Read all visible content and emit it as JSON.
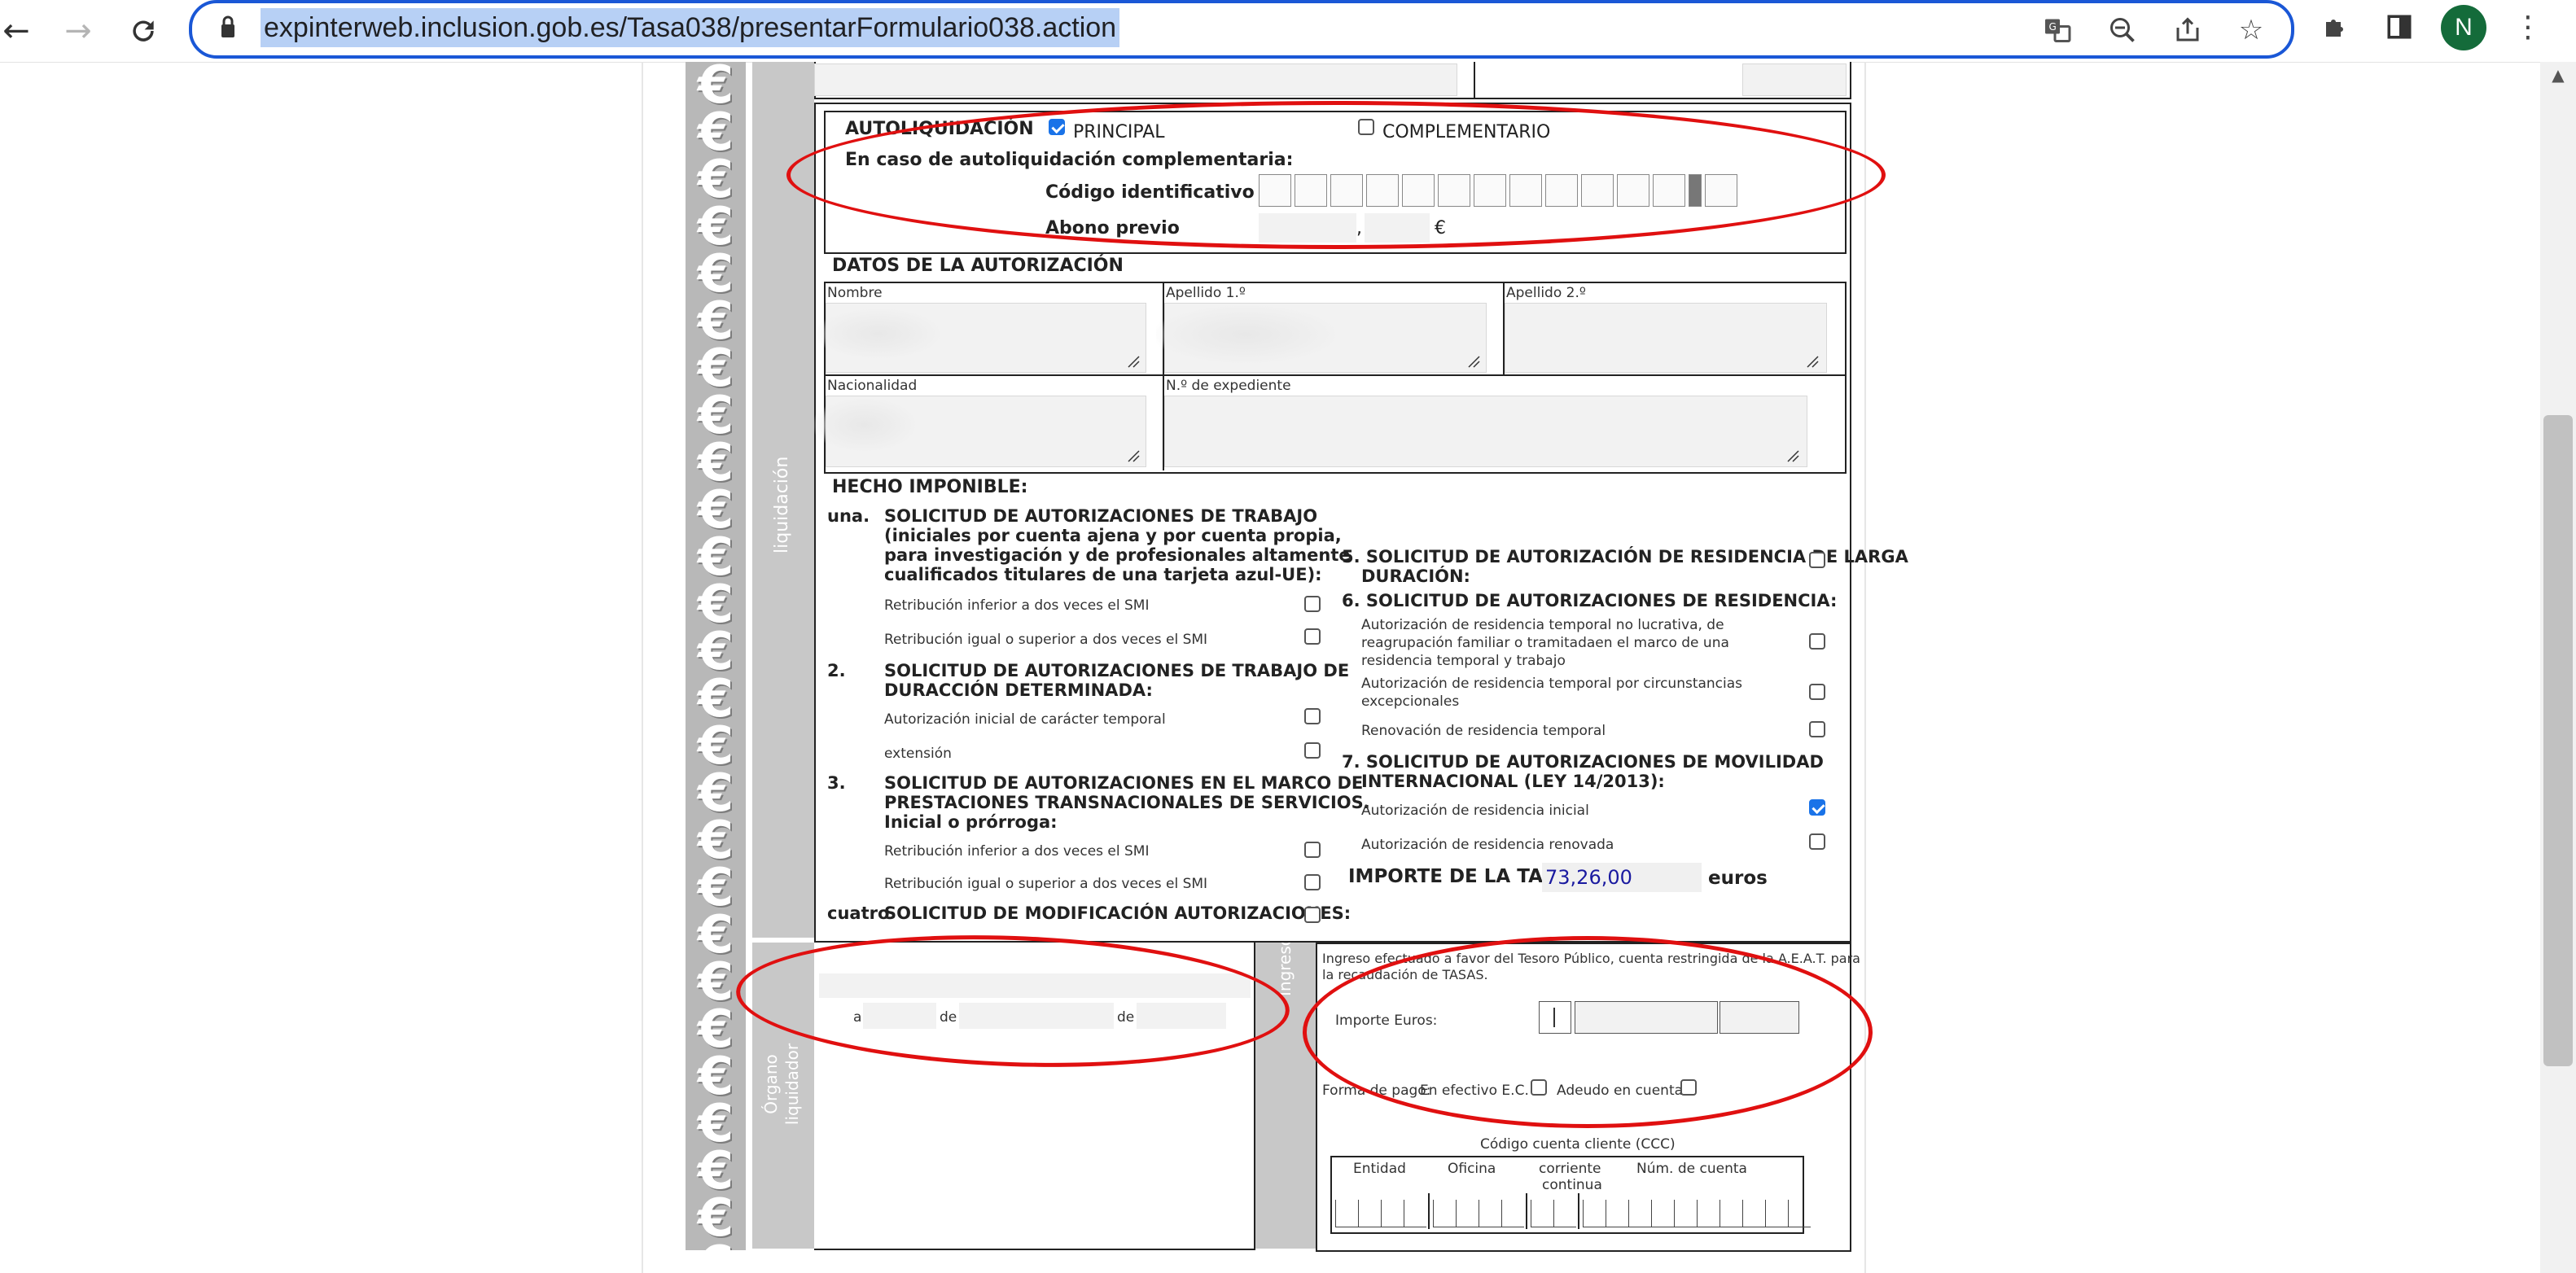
{
  "browser": {
    "url": "expinterweb.inclusion.gob.es/Tasa038/presentarFormulario038.action",
    "avatar_letter": "N",
    "icons": [
      "back-arrow-icon",
      "forward-arrow-icon",
      "reload-icon",
      "lock-icon",
      "translate-icon",
      "zoom-out-icon",
      "share-icon",
      "star-icon",
      "extensions-puzzle-icon",
      "side-panel-icon",
      "more-vert-icon"
    ]
  },
  "side_labels": {
    "liquidacion": "liquidación",
    "organo": "Órgano liquidador",
    "ingreso": "Ingreso"
  },
  "autoliquidacion": {
    "title": "AUTOLIQUIDACIÓN",
    "principal_label": "PRINCIPAL",
    "principal_checked": true,
    "complementario_label": "COMPLEMENTARIO",
    "complementario_checked": false,
    "complementaria_text": "En caso de autoliquidación complementaria:",
    "codigo_label": "Código identificativo",
    "abono_label": "Abono previo",
    "abono_sep": ",",
    "abono_currency": "€"
  },
  "datos": {
    "title": "DATOS DE LA AUTORIZACIÓN",
    "nombre": "Nombre",
    "apellido1": "Apellido 1.º",
    "apellido2": "Apellido 2.º",
    "nacionalidad": "Nacionalidad",
    "expediente": "N.º de expediente"
  },
  "hecho": {
    "title": "HECHO IMPONIBLE:",
    "n1": "una.",
    "s1_lines": [
      "SOLICITUD DE AUTORIZACIONES DE TRABAJO",
      "(iniciales por cuenta ajena y por cuenta propia,",
      "para investigación y de profesionales altamente",
      "cualificados titulares de una tarjeta azul-UE):"
    ],
    "s1a": "Retribución inferior a dos veces el SMI",
    "s1b": "Retribución igual o superior a dos veces el SMI",
    "n2": "2.",
    "s2_lines": [
      "SOLICITUD DE AUTORIZACIONES DE TRABAJO DE",
      "DURACCIÓN DETERMINADA:"
    ],
    "s2a": "Autorización inicial de carácter temporal",
    "s2b": "extensión",
    "n3": "3.",
    "s3_lines": [
      "SOLICITUD DE AUTORIZACIONES EN EL MARCO DE",
      "PRESTACIONES TRANSNACIONALES DE SERVICIOS.",
      "Inicial o prórroga:"
    ],
    "s3a": "Retribución inferior a dos veces el SMI",
    "s3b": "Retribución igual o superior a dos veces el SMI",
    "n4": "cuatro",
    "s4": "SOLICITUD DE MODIFICACIÓN AUTORIZACIONES:",
    "s5_lines": [
      "5. SOLICITUD DE AUTORIZACIÓN DE RESIDENCIA DE LARGA",
      "DURACIÓN:"
    ],
    "s6": "6. SOLICITUD DE AUTORIZACIONES DE RESIDENCIA:",
    "s6a_lines": [
      "Autorización de residencia temporal no lucrativa, de",
      "reagrupación familiar o tramitadaen el marco de una",
      "residencia temporal y trabajo"
    ],
    "s6b_lines": [
      "Autorización de residencia temporal por circunstancias",
      "excepcionales"
    ],
    "s6c": "Renovación de residencia temporal",
    "s7_lines": [
      "7. SOLICITUD DE AUTORIZACIONES DE MOVILIDAD",
      "INTERNACIONAL (LEY 14/2013):"
    ],
    "s7a": "Autorización de residencia inicial",
    "s7a_checked": true,
    "s7b": "Autorización de residencia renovada",
    "importe_label": "IMPORTE DE LA TASA",
    "importe_value": "73,26,00",
    "importe_unit": "euros"
  },
  "organo": {
    "a": "a",
    "de1": "de",
    "de2": "de"
  },
  "ingreso": {
    "text_lines": [
      "Ingreso efectuado a favor del Tesoro Público, cuenta restringida de la A.E.A.T. para",
      "la recaudación de TASAS."
    ],
    "importe_label": "Importe Euros:",
    "forma_pago": "Forma de pago:",
    "efectivo": "En efectivo E.C.",
    "adeudo": "Adeudo en cuenta",
    "ccc_title": "Código cuenta cliente (CCC)",
    "entidad": "Entidad",
    "oficina": "Oficina",
    "dc_lines": [
      "corriente",
      "continua"
    ],
    "num_cuenta": "Núm. de cuenta"
  }
}
